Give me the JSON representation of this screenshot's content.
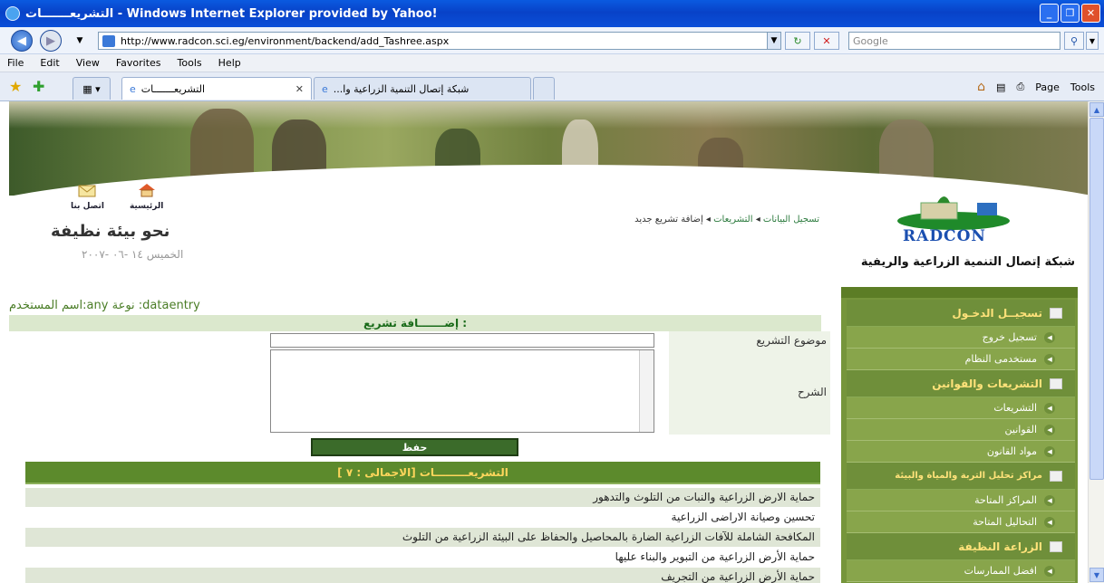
{
  "window": {
    "title": "التشريعـــــــات - Windows Internet Explorer provided by Yahoo!",
    "minimize": "_",
    "restore": "❐",
    "close": "✕"
  },
  "address": {
    "url": "http://www.radcon.sci.eg/environment/backend/add_Tashree.aspx",
    "search_placeholder": "Google"
  },
  "menu": [
    "File",
    "Edit",
    "View",
    "Favorites",
    "Tools",
    "Help"
  ],
  "tabs": [
    {
      "label": "التشريعـــــــات",
      "active": true
    },
    {
      "label": "...شبكة إتصال التنمية الزراعية وا",
      "active": false
    }
  ],
  "commandbar": {
    "home": "⌂",
    "feeds": "▤",
    "print": "⎙",
    "page": "Page",
    "tools": "Tools"
  },
  "header": {
    "icon_home_label": "الرئيسية",
    "icon_contact_label": "اتصل بنا",
    "slogan": "نحو بيئة نظيفة",
    "date": "الخميس ١٤ -٠٦ -٢٠٠٧",
    "crumb_1": "تسجيل البيانات",
    "crumb_2": "التشريعات",
    "crumb_3": "إضافة تشريع جديد",
    "crumb_sep": "◂",
    "logo_text": "RADCON",
    "org_name": "شبكة إتصال التنمية الزراعية والريفية"
  },
  "user_line": "اسم المستخدم:any نوعة :dataentry",
  "form": {
    "title": "إضـــــــافة تشريع :",
    "subject_label": "موضوع التشريع",
    "subject_value": "",
    "description_label": "الشرح",
    "description_value": "",
    "save_label": "حفظ"
  },
  "list": {
    "header": "التشريعـــــــــات [الاجمالى : ٧ ]",
    "items": [
      "حماية الارض الزراعية والنبات من التلوث والتدهور",
      "تحسين وصيانة الاراضى الزراعية",
      "المكافحة الشاملة للآفات الزراعية الضارة بالمحاصيل والحفاظ على البيئة الزراعية من التلوث",
      "حماية الأرض الزراعية من التبوير والبناء عليها",
      "حماية الأرض الزراعية من التجريف"
    ]
  },
  "sidebar": {
    "login_section": "تسجيــل الدخـول",
    "logout": "تسجيل خروج",
    "system_users": "مستخدمى النظام",
    "laws_section": "التشريعات والقوانين",
    "legislation": "التشريعات",
    "laws": "القوانين",
    "law_articles": "مواد القانون",
    "labs_section": "مراكز تحليل التربة والمياة والبيئة",
    "available_centers": "المراكز المتاحة",
    "available_tests": "التحاليل المتاحة",
    "clean_agri_section": "الزراعة النظيفة",
    "best_practices": "افضل الممارسات"
  },
  "colors": {
    "accent_green": "#5c8a2c",
    "title_blue": "#0a4fd8",
    "sidebar_gold": "#ffe27a"
  }
}
